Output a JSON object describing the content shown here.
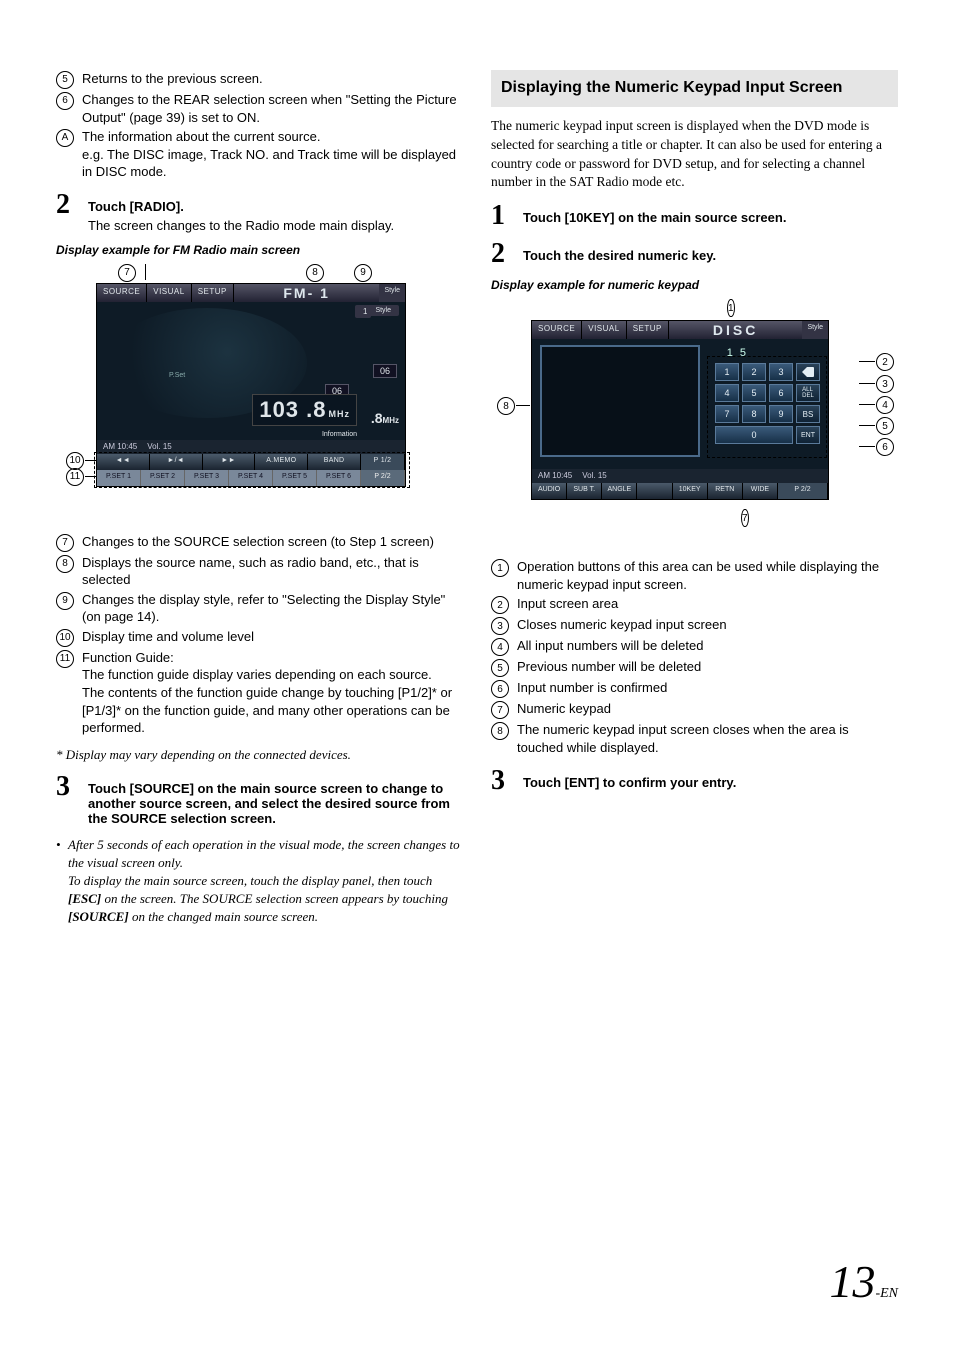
{
  "left": {
    "list1": [
      {
        "n": "5",
        "text": "Returns to the previous screen."
      },
      {
        "n": "6",
        "text": "Changes to the REAR selection screen when \"Setting the Picture Output\" (page 39) is set to ON."
      },
      {
        "n": "A",
        "text": "The information about the current source.\ne.g. The DISC image, Track NO. and Track time will be displayed in DISC mode.",
        "oval": true
      }
    ],
    "step2": {
      "num": "2",
      "line1a": "Touch ",
      "line1b": "[RADIO]",
      "line1c": ".",
      "sub": "The screen changes to the Radio mode main display."
    },
    "caption1": "Display example for FM Radio main screen",
    "fm": {
      "menu": [
        "SOURCE",
        "VISUAL",
        "SETUP"
      ],
      "title": "FM- 1",
      "style": "Style",
      "pill_num": "1",
      "pill_style": "Style",
      "pset": "P.Set",
      "ch": "06",
      "ch2": "06",
      "freq": "103 .8",
      "unit": "MHz",
      "freq2": ".8",
      "unit2": "MHz",
      "info": "Information",
      "status_time": "AM 10:45",
      "status_vol": "Vol. 15",
      "fn": [
        "◄◄",
        "►/◄",
        "►►",
        "A.MEMO",
        "BAND"
      ],
      "fn_page": "P 1/2",
      "presets": [
        "P.SET 1",
        "P.SET 2",
        "P.SET 3",
        "P.SET 4",
        "P.SET 5",
        "P.SET 6"
      ],
      "preset_page": "P 2/2",
      "callouts": {
        "c7": "7",
        "c8": "8",
        "c9": "9",
        "c10": "10",
        "c11": "11"
      }
    },
    "list2": [
      {
        "n": "7",
        "text": "Changes to the SOURCE selection screen (to Step 1 screen)"
      },
      {
        "n": "8",
        "text": "Displays the source name, such as radio band, etc., that is selected"
      },
      {
        "n": "9",
        "text": "Changes the display style, refer to \"Selecting the Display Style\" (on page 14)."
      },
      {
        "n": "10",
        "text": "Display time and volume level"
      },
      {
        "n": "11",
        "text": "Function Guide:\nThe function guide display varies depending on each source.\nThe contents of the function guide change by touching [P1/2]* or [P1/3]* on the function guide, and many other operations can be performed."
      }
    ],
    "asterisk": "* Display may vary depending on the connected devices.",
    "step3": {
      "num": "3",
      "line_a": "Touch ",
      "line_b": "[SOURCE]",
      "line_c": " on the main source screen to change to another source screen, and select the desired source from the SOURCE selection screen."
    },
    "note_a": "After 5 seconds of each operation in the visual mode, the screen changes to the visual screen only.\nTo display the main source screen, touch the display panel, then touch ",
    "note_b": "[ESC]",
    "note_c": " on the screen. The SOURCE selection screen appears by touching ",
    "note_d": "[SOURCE]",
    "note_e": " on the changed main source screen."
  },
  "right": {
    "heading": "Displaying the Numeric Keypad Input Screen",
    "intro": "The numeric keypad input screen is displayed when the DVD mode is selected for searching a title or chapter. It can also be used for entering a country code or password for DVD setup, and for selecting a channel number in the SAT Radio mode etc.",
    "step1": {
      "num": "1",
      "a": "Touch ",
      "b": "[10KEY]",
      "c": " on the main source screen."
    },
    "step2": {
      "num": "2",
      "a": "Touch the desired numeric key."
    },
    "caption": "Display example for numeric keypad",
    "disc": {
      "menu": [
        "SOURCE",
        "VISUAL",
        "SETUP"
      ],
      "title": "DISC",
      "style": "Style",
      "input_val": "1 5",
      "keys": [
        "1",
        "2",
        "3",
        "back",
        "4",
        "5",
        "6",
        "ALL\nDEL",
        "7",
        "8",
        "9",
        "BS",
        "0wide",
        "ENT"
      ],
      "status_time": "AM 10:45",
      "status_vol": "Vol. 15",
      "fn": [
        "AUDIO",
        "SUB T.",
        "ANGLE",
        "",
        "10KEY",
        "RETN",
        "WIDE"
      ],
      "fn_page": "P 2/2",
      "callouts": {
        "c1": "1",
        "c2": "2",
        "c3": "3",
        "c4": "4",
        "c5": "5",
        "c6": "6",
        "c7": "7",
        "c8": "8"
      }
    },
    "list": [
      {
        "n": "1",
        "text": "Operation buttons of this area can be used while displaying the numeric keypad input screen."
      },
      {
        "n": "2",
        "text": "Input screen area"
      },
      {
        "n": "3",
        "text": "Closes numeric keypad input screen"
      },
      {
        "n": "4",
        "text": "All input numbers will be deleted"
      },
      {
        "n": "5",
        "text": "Previous number will be deleted"
      },
      {
        "n": "6",
        "text": "Input number is confirmed"
      },
      {
        "n": "7",
        "text": "Numeric keypad"
      },
      {
        "n": "8",
        "text": "The numeric keypad input screen closes when the area is touched while displayed."
      }
    ],
    "step3": {
      "num": "3",
      "a": "Touch ",
      "b": "[ENT]",
      "c": " to confirm your entry."
    }
  },
  "page": {
    "num": "13",
    "suf": "-EN"
  }
}
